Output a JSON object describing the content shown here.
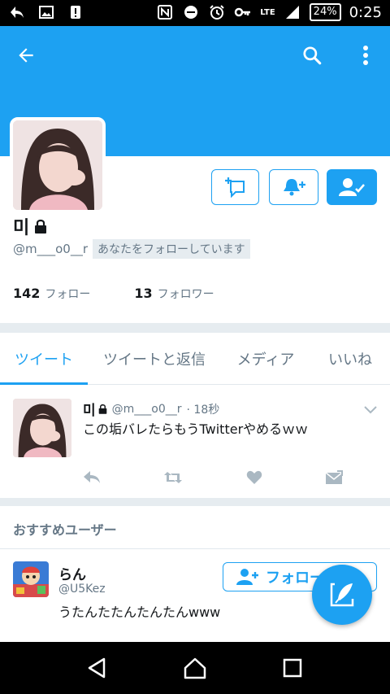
{
  "status_bar": {
    "network": "LTE",
    "battery": "24%",
    "time": "0:25"
  },
  "profile": {
    "name": "미",
    "handle": "@m___o0__r",
    "follows_you": "あなたをフォローしています",
    "following_count": "142",
    "following_label": "フォロー",
    "followers_count": "13",
    "followers_label": "フォロワー"
  },
  "tabs": [
    {
      "label": "ツイート",
      "active": true
    },
    {
      "label": "ツイートと返信",
      "active": false
    },
    {
      "label": "メディア",
      "active": false
    },
    {
      "label": "いいね",
      "active": false
    }
  ],
  "tweet": {
    "name": "미",
    "handle": "@m___o0__r",
    "time": "· 18秒",
    "text": "この垢バレたらもうTwitterやめるｗｗ"
  },
  "recommended": {
    "heading": "おすすめユーザー",
    "user": {
      "name": "らん",
      "handle": "@U5Kez",
      "bio": "うたんたたんたんたんwww",
      "follow_label": "フォロー"
    }
  },
  "colors": {
    "accent": "#1da1f2",
    "text": "#14171a",
    "muted": "#657786"
  }
}
